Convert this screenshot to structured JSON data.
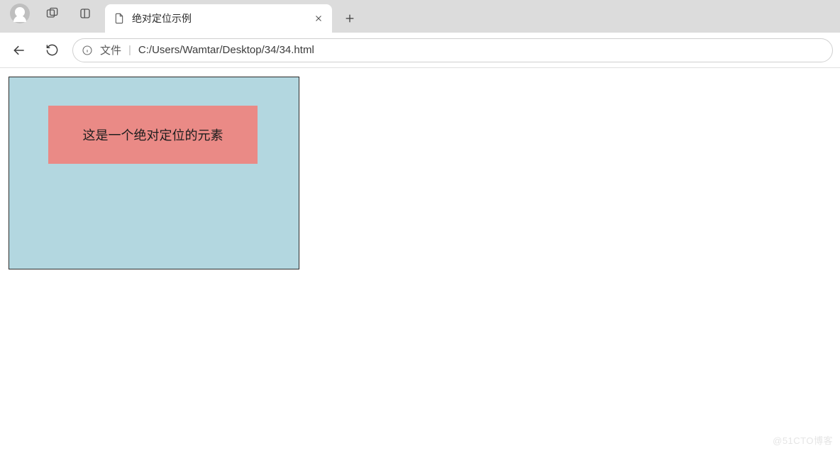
{
  "chrome": {
    "tab_title": "绝对定位示例",
    "new_tab_tooltip": "新建标签页"
  },
  "toolbar": {
    "file_label": "文件",
    "url_path": "C:/Users/Wamtar/Desktop/34/34.html"
  },
  "page": {
    "box_text": "这是一个绝对定位的元素"
  },
  "watermark": "@51CTO博客"
}
